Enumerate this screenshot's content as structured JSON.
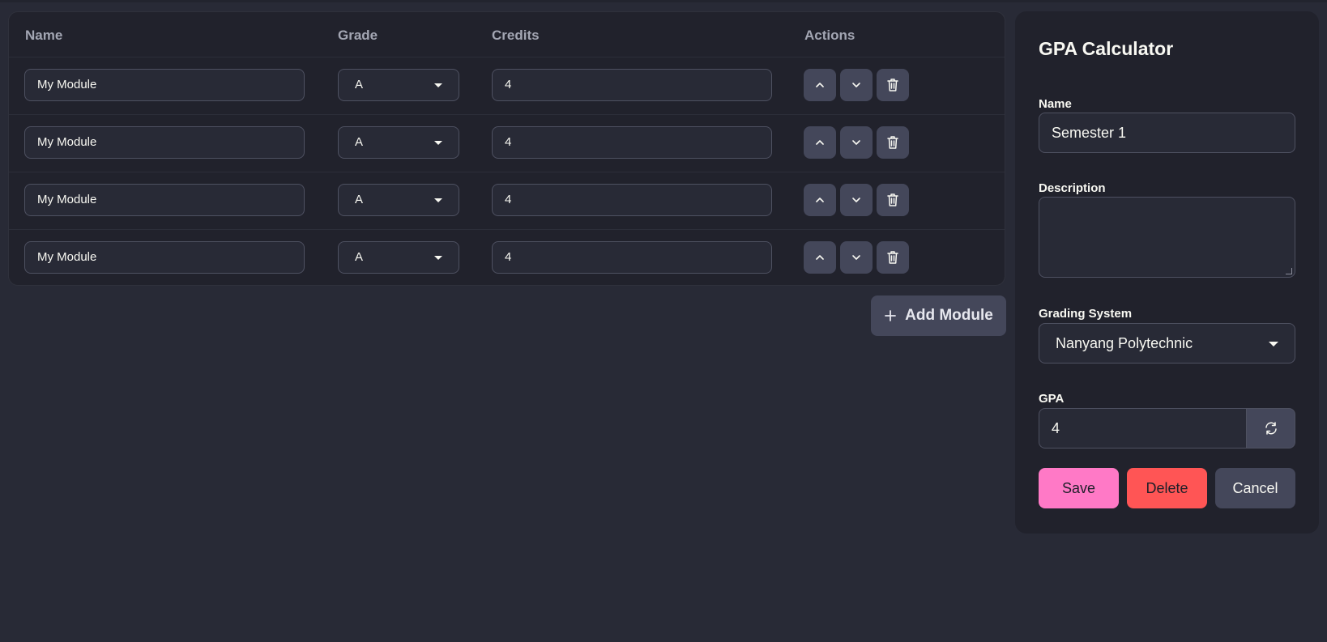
{
  "table": {
    "headers": {
      "name": "Name",
      "grade": "Grade",
      "credits": "Credits",
      "actions": "Actions"
    },
    "rows": [
      {
        "name": "My Module",
        "grade": "A",
        "credits": "4"
      },
      {
        "name": "My Module",
        "grade": "A",
        "credits": "4"
      },
      {
        "name": "My Module",
        "grade": "A",
        "credits": "4"
      },
      {
        "name": "My Module",
        "grade": "A",
        "credits": "4"
      }
    ],
    "row_actions": [
      "chevron-up-icon",
      "chevron-down-icon",
      "trash-icon"
    ]
  },
  "add_module": {
    "label": "Add Module",
    "icon": "plus-icon"
  },
  "panel": {
    "title": "GPA Calculator",
    "name_label": "Name",
    "name_value": "Semester 1",
    "description_label": "Description",
    "description_value": "",
    "grading_label": "Grading System",
    "grading_value": "Nanyang Polytechnic",
    "gpa_label": "GPA",
    "gpa_value": "4",
    "refresh_icon": "refresh-icon",
    "save_label": "Save",
    "delete_label": "Delete",
    "cancel_label": "Cancel"
  },
  "colors": {
    "background": "#282a36",
    "surface": "#21222c",
    "button": "#44475a",
    "save": "#ff79c6",
    "delete": "#ff5555"
  }
}
